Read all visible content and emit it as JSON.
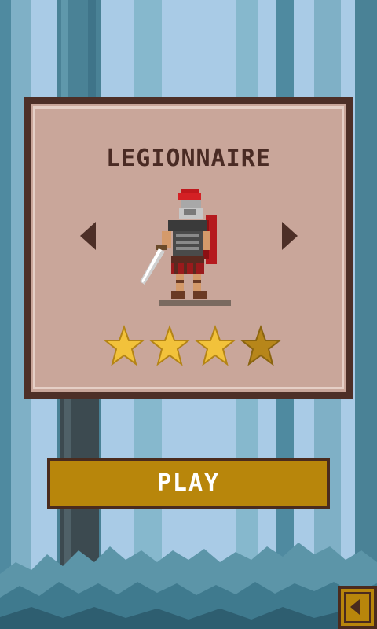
{
  "character": {
    "name": "LEGIONNAIRE",
    "difficulty_stars": {
      "filled": 3,
      "total": 4
    }
  },
  "actions": {
    "play_label": "PLAY"
  },
  "icons": {
    "prev": "arrow-left-icon",
    "next": "arrow-right-icon",
    "back": "back-arrow-icon",
    "star": "star-icon"
  },
  "colors": {
    "panel_bg": "#c9a69a",
    "panel_border": "#4d2f27",
    "button_gold": "#b8860b",
    "star_filled": "#f2c23b",
    "star_empty": "#b7861a",
    "sky": "#a9cbe6"
  }
}
